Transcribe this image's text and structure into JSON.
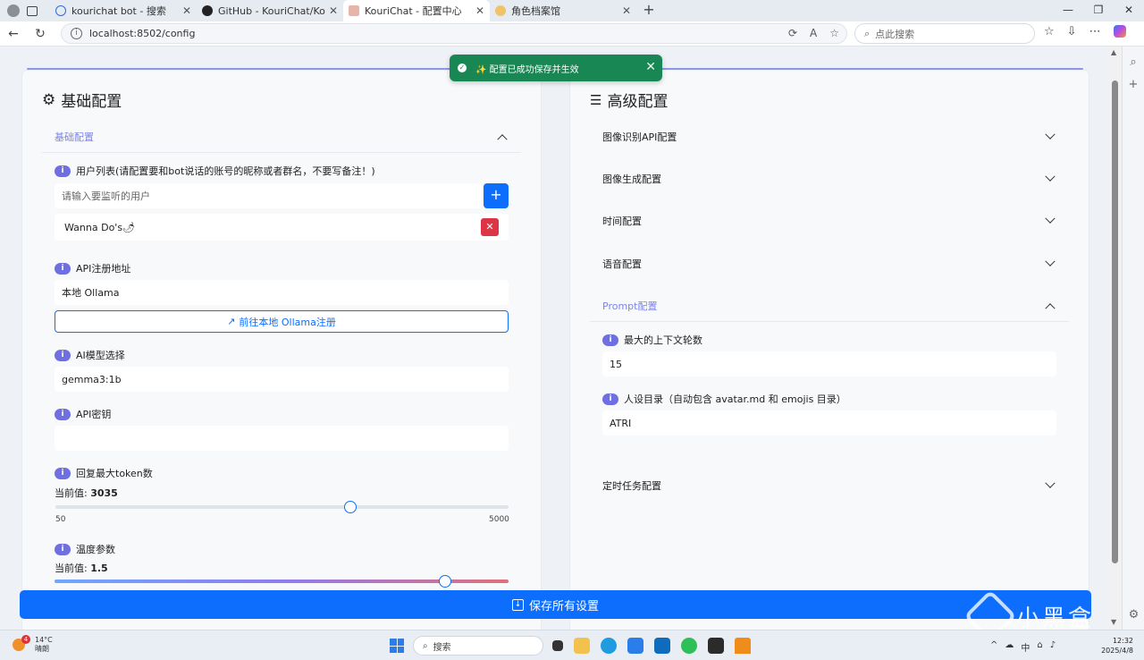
{
  "browser": {
    "tabs": [
      {
        "label": "kourichat bot - 搜索",
        "active": false
      },
      {
        "label": "GitHub - KouriChat/KouriChat: 可...",
        "active": false
      },
      {
        "label": "KouriChat - 配置中心",
        "active": true
      },
      {
        "label": "角色档案馆",
        "active": false
      }
    ],
    "url": "localhost:8502/config",
    "search_placeholder": "点此搜索"
  },
  "toast": {
    "message": "✨ 配置已成功保存并生效"
  },
  "left": {
    "title": "基础配置",
    "section_label": "基础配置",
    "user_list_label": "用户列表(请配置要和bot说话的账号的昵称或者群名，不要写备注！)",
    "user_input_placeholder": "请输入要监听的用户",
    "users": [
      "Wanna Do's🌶"
    ],
    "api_url_label": "API注册地址",
    "api_url_value": "本地 Ollama",
    "api_register_button": "前往本地 Ollama注册",
    "model_label": "AI模型选择",
    "model_value": "gemma3:1b",
    "api_key_label": "API密钥",
    "api_key_value": "",
    "max_token_label": "回复最大token数",
    "current_prefix": "当前值:",
    "max_token_value": "3035",
    "max_token_min": "50",
    "max_token_max": "5000",
    "max_token_fraction": 0.603,
    "temperature_label": "温度参数",
    "temperature_value": "1.5",
    "temperature_fraction": 0.86
  },
  "right": {
    "title": "高级配置",
    "sections": [
      {
        "label": "图像识别API配置",
        "expanded": false
      },
      {
        "label": "图像生成配置",
        "expanded": false
      },
      {
        "label": "时间配置",
        "expanded": false
      },
      {
        "label": "语音配置",
        "expanded": false
      },
      {
        "label": "Prompt配置",
        "expanded": true
      },
      {
        "label": "定时任务配置",
        "expanded": false
      }
    ],
    "max_context_label": "最大的上下文轮数",
    "max_context_value": "15",
    "persona_label": "人设目录（自动包含 avatar.md 和 emojis 目录）",
    "persona_value": "ATRI"
  },
  "save_button": "保存所有设置",
  "watermark": "小黑盒",
  "taskbar": {
    "weather_temp": "14°C",
    "weather_text": "晴朗",
    "weather_badge": "4",
    "search_label": "搜索",
    "ime": "中",
    "time": "12:32",
    "date": "2025/4/8"
  },
  "colors": {
    "primary": "#0d6efd",
    "danger": "#dc3545",
    "success": "#198754",
    "accent": "#7c84e8"
  }
}
